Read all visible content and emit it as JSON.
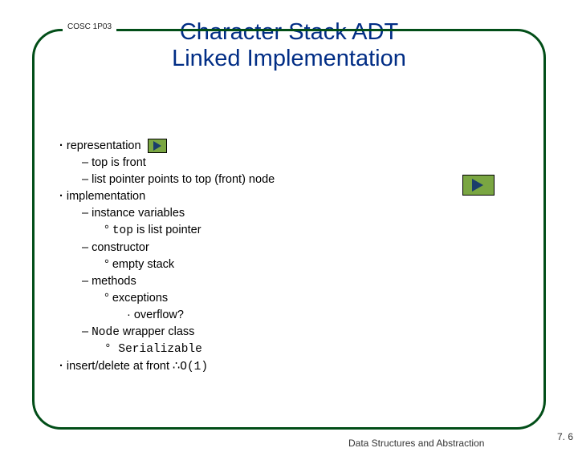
{
  "course": "COSC 1P03",
  "title_line1": "Character Stack ADT",
  "title_line2": "Linked Implementation",
  "bullets": {
    "representation": "representation",
    "top_front": "top is front",
    "list_ptr": "list pointer points to top (front) node",
    "implementation": "implementation",
    "inst_vars": "instance variables",
    "top_is": " is list pointer",
    "top_code": "top",
    "constructor": "constructor",
    "empty_stack": "empty stack",
    "methods": "methods",
    "exceptions": "exceptions",
    "overflow": "overflow?",
    "node_wrapper_pre": "Node",
    "node_wrapper_post": " wrapper class",
    "serializable": "Serializable",
    "insert_delete": "insert/delete at front ",
    "therefore": "∴",
    "o1": "O(1)"
  },
  "footer": "Data Structures and Abstraction",
  "page": "7. 6"
}
